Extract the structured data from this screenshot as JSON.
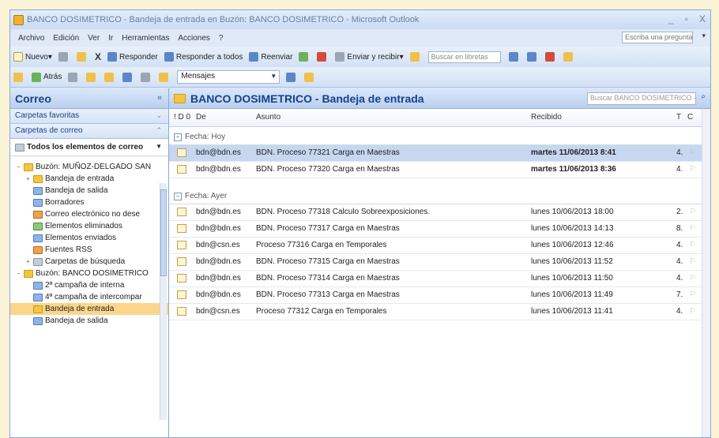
{
  "window": {
    "title": "BANCO DOSIMETRICO - Bandeja de entrada en Buzón: BANCO DOSIMETRICO - Microsoft Outlook",
    "minimize": "_",
    "maximize": "▫",
    "close": "X"
  },
  "menu": {
    "items": [
      "Archivo",
      "Edición",
      "Ver",
      "Ir",
      "Herramientas",
      "Acciones",
      "?"
    ],
    "help_placeholder": "Escriba una pregunta"
  },
  "toolbar1": {
    "new": "Nuevo",
    "reply": "Responder",
    "reply_all": "Responder a todos",
    "forward": "Reenviar",
    "send_receive": "Enviar y recibir",
    "search_placeholder": "Buscar en libretas"
  },
  "toolbar2": {
    "back": "Atrás",
    "messages_select": "Mensajes"
  },
  "nav": {
    "title": "Correo",
    "favorites": "Carpetas favoritas",
    "mail_folders": "Carpetas de correo",
    "all_items": "Todos los elementos de correo",
    "tree": [
      {
        "label": "Buzón: MUÑOZ-DELGADO SAN",
        "level": 0,
        "exp": "−"
      },
      {
        "label": "Bandeja de entrada",
        "level": 1,
        "exp": "+"
      },
      {
        "label": "Bandeja de salida",
        "level": 1,
        "exp": ""
      },
      {
        "label": "Borradores",
        "level": 1,
        "exp": ""
      },
      {
        "label": "Correo electrónico no dese",
        "level": 1,
        "exp": ""
      },
      {
        "label": "Elementos eliminados",
        "level": 1,
        "exp": ""
      },
      {
        "label": "Elementos enviados",
        "level": 1,
        "exp": ""
      },
      {
        "label": "Fuentes RSS",
        "level": 1,
        "exp": ""
      },
      {
        "label": "Carpetas de búsqueda",
        "level": 1,
        "exp": "+"
      },
      {
        "label": "Buzón: BANCO DOSIMETRICO",
        "level": 0,
        "exp": "−"
      },
      {
        "label": "2ª campaña de interna",
        "level": 1,
        "exp": ""
      },
      {
        "label": "4ª campaña de intercompar",
        "level": 1,
        "exp": ""
      },
      {
        "label": "Bandeja de entrada",
        "level": 1,
        "exp": "",
        "selected": true
      },
      {
        "label": "Bandeja de salida",
        "level": 1,
        "exp": ""
      }
    ]
  },
  "main": {
    "title": "BANCO DOSIMETRICO - Bandeja de entrada",
    "search_placeholder": "Buscar BANCO DOSIMETRICO - Bandej",
    "columns": {
      "icons": "! D 0",
      "from": "De",
      "subject": "Asunto",
      "received": "Recibido",
      "size": "T",
      "flag": "C"
    },
    "groups": [
      {
        "label": "Fecha: Hoy",
        "rows": [
          {
            "from": "bdn@bdn.es",
            "subject": "BDN. Proceso 77321 Carga en Maestras",
            "received": "martes 11/06/2013 8:41",
            "size": "4.",
            "selected": true
          },
          {
            "from": "bdn@bdn.es",
            "subject": "BDN. Proceso 77320 Carga en Maestras",
            "received": "martes 11/06/2013 8:36",
            "size": "4."
          }
        ]
      },
      {
        "label": "Fecha: Ayer",
        "rows": [
          {
            "from": "bdn@bdn.es",
            "subject": "BDN. Proceso 77318 Calculo Sobreexposiciones.",
            "received": "lunes 10/06/2013 18:00",
            "size": "2."
          },
          {
            "from": "bdn@bdn.es",
            "subject": "BDN. Proceso 77317 Carga en Maestras",
            "received": "lunes 10/06/2013 14:13",
            "size": "8."
          },
          {
            "from": "bdn@csn.es",
            "subject": "Proceso 77316 Carga en Temporales",
            "received": "lunes 10/06/2013 12:46",
            "size": "4."
          },
          {
            "from": "bdn@bdn.es",
            "subject": "BDN. Proceso 77315 Carga en Maestras",
            "received": "lunes 10/06/2013 11:52",
            "size": "4."
          },
          {
            "from": "bdn@bdn.es",
            "subject": "BDN. Proceso 77314 Carga en Maestras",
            "received": "lunes 10/06/2013 11:50",
            "size": "4."
          },
          {
            "from": "bdn@bdn.es",
            "subject": "BDN. Proceso 77313 Carga en Maestras",
            "received": "lunes 10/06/2013 11:49",
            "size": "7."
          },
          {
            "from": "bdn@csn.es",
            "subject": "Proceso 77312 Carga en Temporales",
            "received": "lunes 10/06/2013 11:41",
            "size": "4."
          }
        ]
      }
    ]
  }
}
